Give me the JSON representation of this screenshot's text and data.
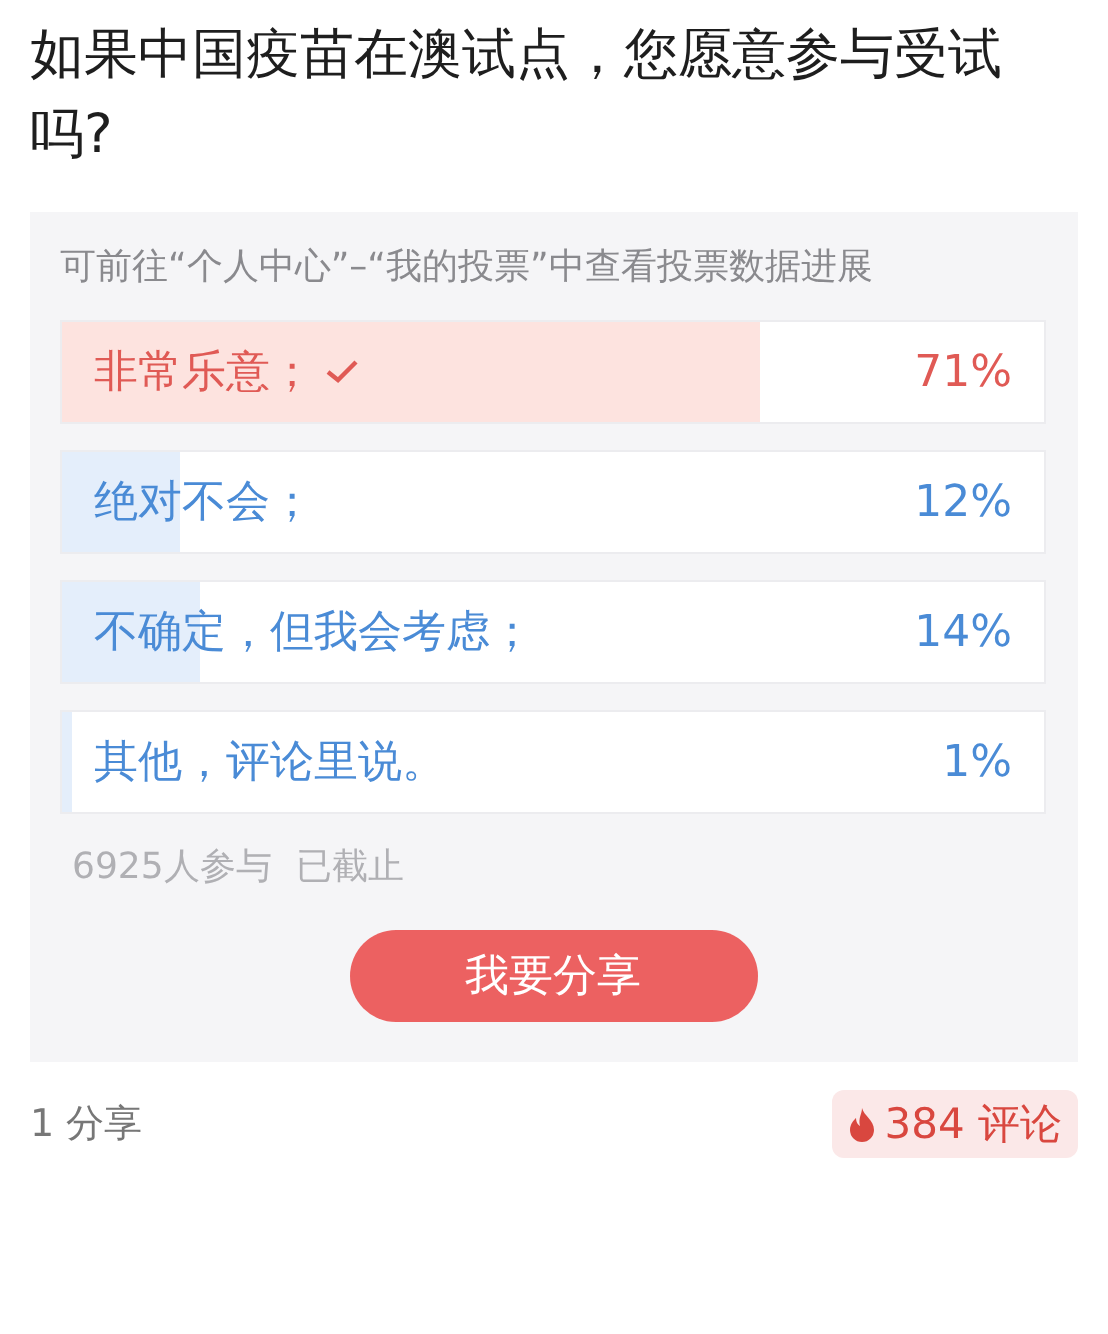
{
  "title": "如果中国疫苗在澳试点，您愿意参与受试吗?",
  "poll": {
    "hint": "可前往“个人中心”–“我的投票”中查看投票数据进展",
    "options": [
      {
        "label": "非常乐意；",
        "percent": "71%",
        "level": 0.71,
        "selected": true
      },
      {
        "label": "绝对不会；",
        "percent": "12%",
        "level": 0.12,
        "selected": false
      },
      {
        "label": "不确定，但我会考虑；",
        "percent": "14%",
        "level": 0.14,
        "selected": false
      },
      {
        "label": "其他，评论里说。",
        "percent": "1%",
        "level": 0.01,
        "selected": false
      }
    ],
    "participants": "6925人参与",
    "status": "已截止",
    "share_button": "我要分享"
  },
  "footer": {
    "shares": "1 分享",
    "comments": "384 评论"
  }
}
